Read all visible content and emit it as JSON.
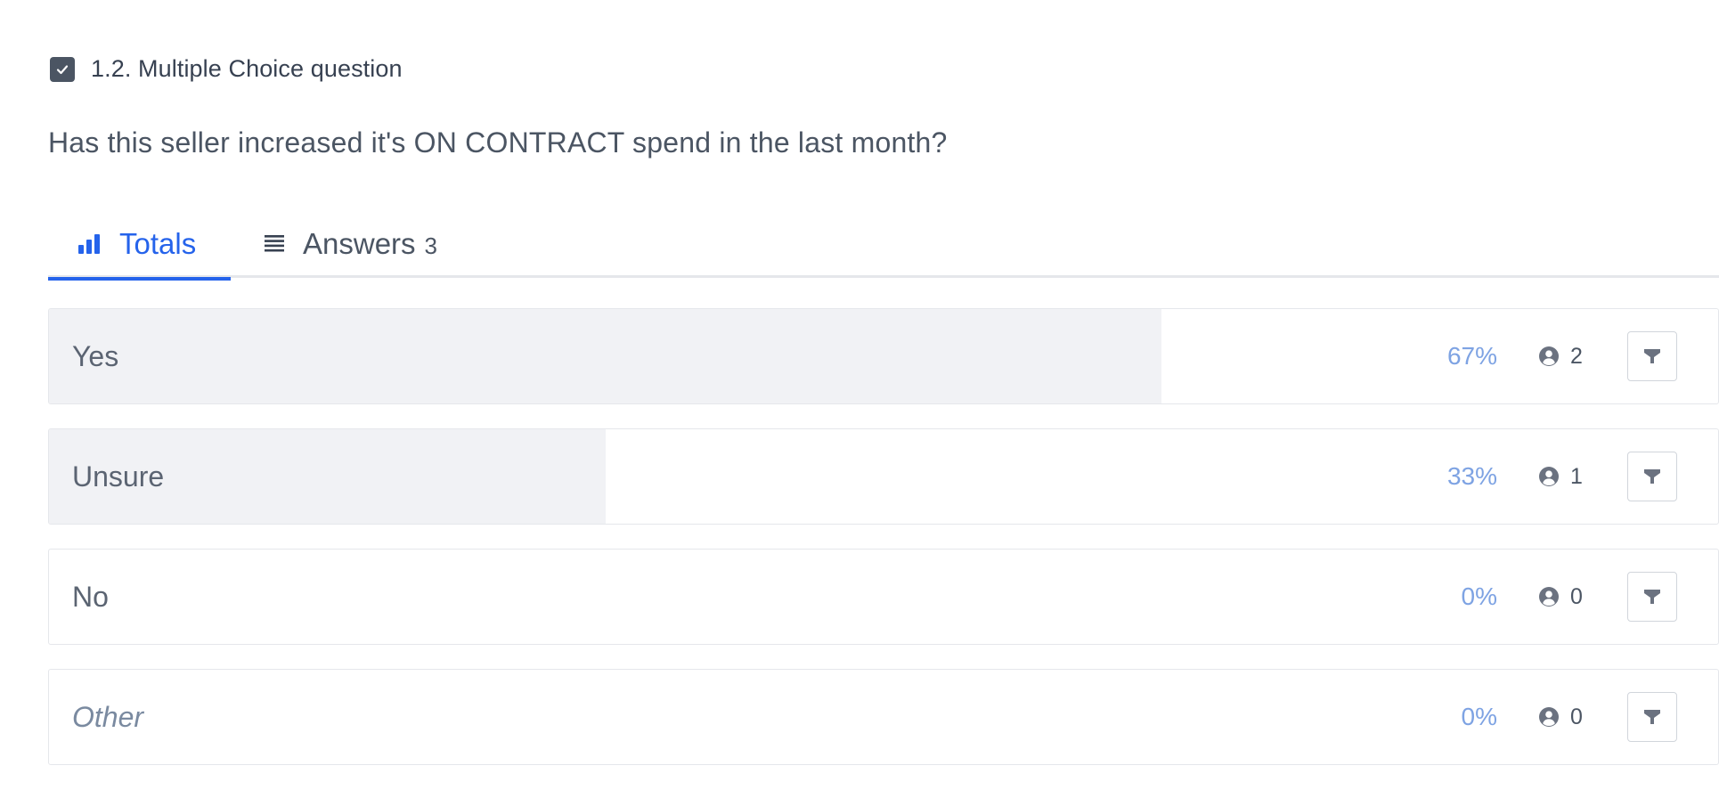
{
  "question": {
    "title": "1.2. Multiple Choice question",
    "text": "Has this seller increased it's ON CONTRACT spend in the last month?",
    "checked": true
  },
  "tabs": [
    {
      "label": "Totals",
      "icon": "bar-chart-icon",
      "active": true
    },
    {
      "label": "Answers",
      "icon": "list-icon",
      "count": "3",
      "active": false
    }
  ],
  "options": [
    {
      "label": "Yes",
      "percent": "67%",
      "fraction": 0.6667,
      "respondents": "2",
      "italic": false
    },
    {
      "label": "Unsure",
      "percent": "33%",
      "fraction": 0.3333,
      "respondents": "1",
      "italic": false
    },
    {
      "label": "No",
      "percent": "0%",
      "fraction": 0,
      "respondents": "0",
      "italic": false
    },
    {
      "label": "Other",
      "percent": "0%",
      "fraction": 0,
      "respondents": "0",
      "italic": true
    }
  ],
  "colors": {
    "accent": "#2563eb",
    "percent": "#7ea3e3",
    "fill": "#f1f2f5",
    "checkbox": "#4b5563"
  }
}
